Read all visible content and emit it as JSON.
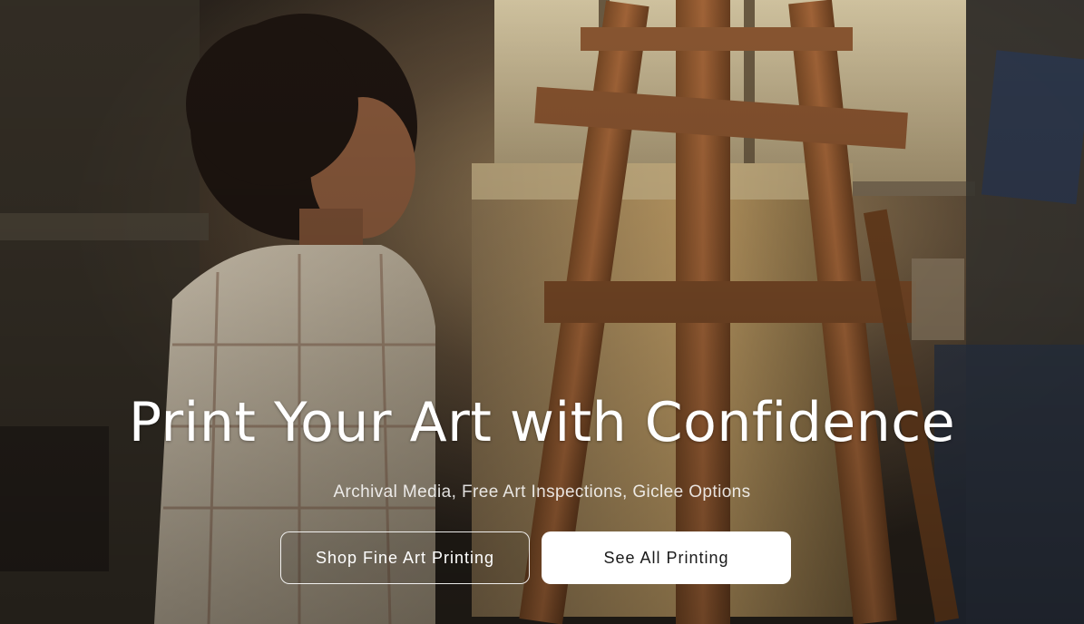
{
  "hero": {
    "headline": "Print Your Art with Confidence",
    "subheadline": "Archival Media, Free Art Inspections, Giclee Options",
    "buttons": {
      "primary_label": "Shop Fine Art Printing",
      "secondary_label": "See All Printing"
    }
  },
  "colors": {
    "headline_text": "#ffffff",
    "button_solid_bg": "#ffffff",
    "button_solid_text": "#1a1a1a",
    "button_outline_border": "#ffffff"
  }
}
